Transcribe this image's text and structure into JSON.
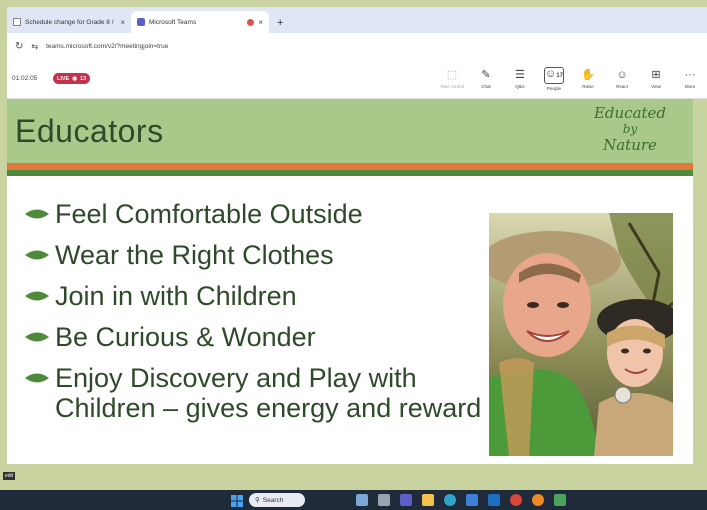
{
  "browser": {
    "tabs": [
      {
        "title": "Schedule change for Grade 8 / ",
        "active": false
      },
      {
        "title": "Microsoft Teams",
        "active": true
      }
    ],
    "new_tab": "+",
    "close_glyph": "×",
    "url": "teams.microsoft.com/v2/?meetingjoin=true"
  },
  "meeting": {
    "timer": "01:02:05",
    "live_label": "LIVE",
    "viewer_count": "13",
    "toolbar": [
      {
        "label": "Take control",
        "icon": "take-control-icon",
        "dim": true
      },
      {
        "label": "Chat",
        "icon": "chat-icon"
      },
      {
        "label": "Q&A",
        "icon": "qna-icon"
      },
      {
        "label": "People",
        "icon": "people-icon",
        "badge": "17",
        "selected": true
      },
      {
        "label": "Raise",
        "icon": "raise-hand-icon"
      },
      {
        "label": "React",
        "icon": "react-icon"
      },
      {
        "label": "View",
        "icon": "view-icon"
      },
      {
        "label": "More",
        "icon": "more-icon"
      }
    ]
  },
  "slide": {
    "title": "Educators",
    "logo_lines": [
      "Educated",
      "by",
      "Nature"
    ],
    "bullets": [
      "Feel Comfortable Outside",
      "Wear the Right Clothes",
      "Join in with Children",
      "Be Curious & Wonder",
      "Enjoy Discovery and Play with Children – gives energy and reward"
    ],
    "colors": {
      "header": "#a8c98a",
      "text": "#2f4a2a",
      "orange": "#e0793a",
      "green": "#4f8a3c",
      "leaf": "#4f8a3c"
    }
  },
  "taskbar": {
    "search_placeholder": "Search",
    "corner_label": "edit"
  }
}
